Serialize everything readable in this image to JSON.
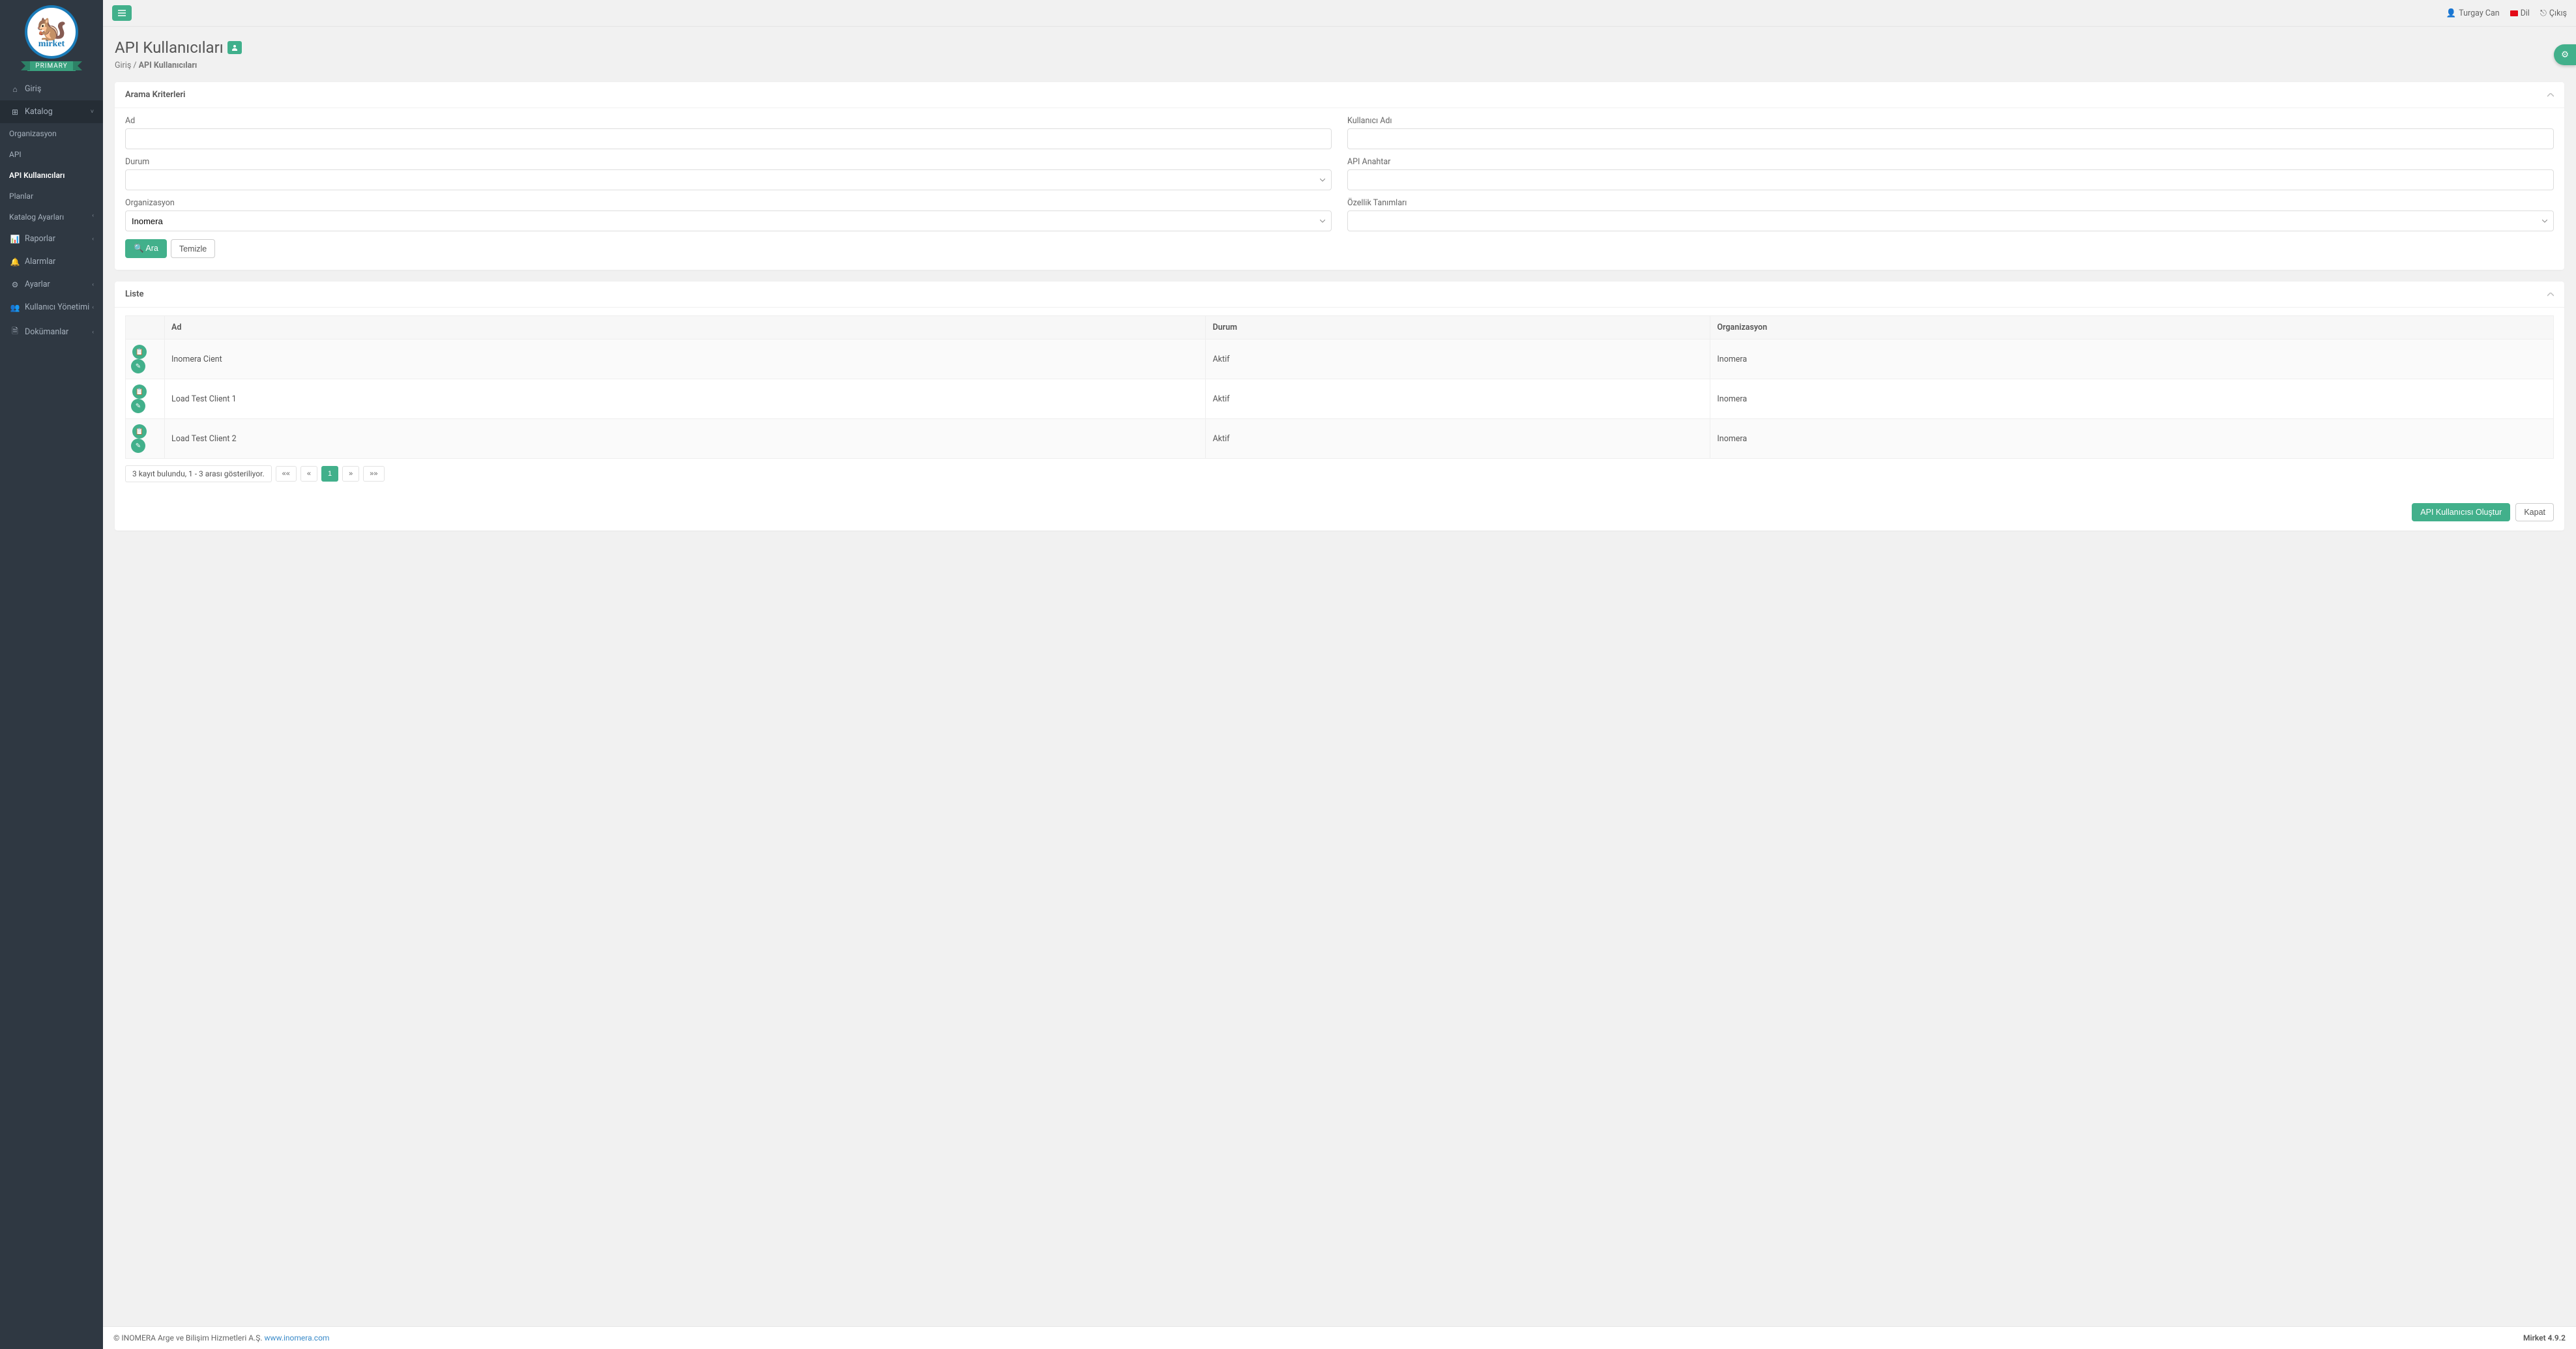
{
  "brand": {
    "name": "mirket",
    "ribbon": "PRIMARY"
  },
  "topbar": {
    "user": "Turgay Can",
    "lang": "Dil",
    "logout": "Çıkış"
  },
  "sidebar": {
    "home": "Giriş",
    "catalog": "Katalog",
    "catalog_items": {
      "org": "Organizasyon",
      "api": "API",
      "api_users": "API Kullanıcıları",
      "plans": "Planlar",
      "catalog_settings": "Katalog Ayarları"
    },
    "reports": "Raporlar",
    "alarms": "Alarmlar",
    "settings": "Ayarlar",
    "user_mgmt": "Kullanıcı Yönetimi",
    "docs": "Dokümanlar"
  },
  "page": {
    "title": "API Kullanıcıları",
    "breadcrumb_home": "Giriş",
    "breadcrumb_current": "API Kullanıcıları"
  },
  "search": {
    "panel_title": "Arama Kriterleri",
    "labels": {
      "ad": "Ad",
      "kullanici_adi": "Kullanıcı Adı",
      "durum": "Durum",
      "api_anahtar": "API Anahtar",
      "organizasyon": "Organizasyon",
      "ozellik": "Özellik Tanımları"
    },
    "values": {
      "ad": "",
      "kullanici_adi": "",
      "durum": "",
      "api_anahtar": "",
      "organizasyon": "Inomera",
      "ozellik": ""
    },
    "search_btn": "Ara",
    "clear_btn": "Temizle"
  },
  "list": {
    "panel_title": "Liste",
    "columns": {
      "ad": "Ad",
      "durum": "Durum",
      "organizasyon": "Organizasyon"
    },
    "rows": [
      {
        "ad": "Inomera Cient",
        "durum": "Aktif",
        "organizasyon": "Inomera"
      },
      {
        "ad": "Load Test Client 1",
        "durum": "Aktif",
        "organizasyon": "Inomera"
      },
      {
        "ad": "Load Test Client 2",
        "durum": "Aktif",
        "organizasyon": "Inomera"
      }
    ],
    "pager_info": "3 kayıt bulundu, 1 - 3 arası gösteriliyor.",
    "pager": {
      "first": "««",
      "prev": "«",
      "current": "1",
      "next": "»",
      "last": "»»"
    },
    "create_btn": "API Kullanıcısı Oluştur",
    "close_btn": "Kapat"
  },
  "footer": {
    "copyright": "© INOMERA Arge ve Bilişim Hizmetleri A.Ş. ",
    "link_text": "www.inomera.com",
    "version": "Mirket 4.9.2"
  }
}
